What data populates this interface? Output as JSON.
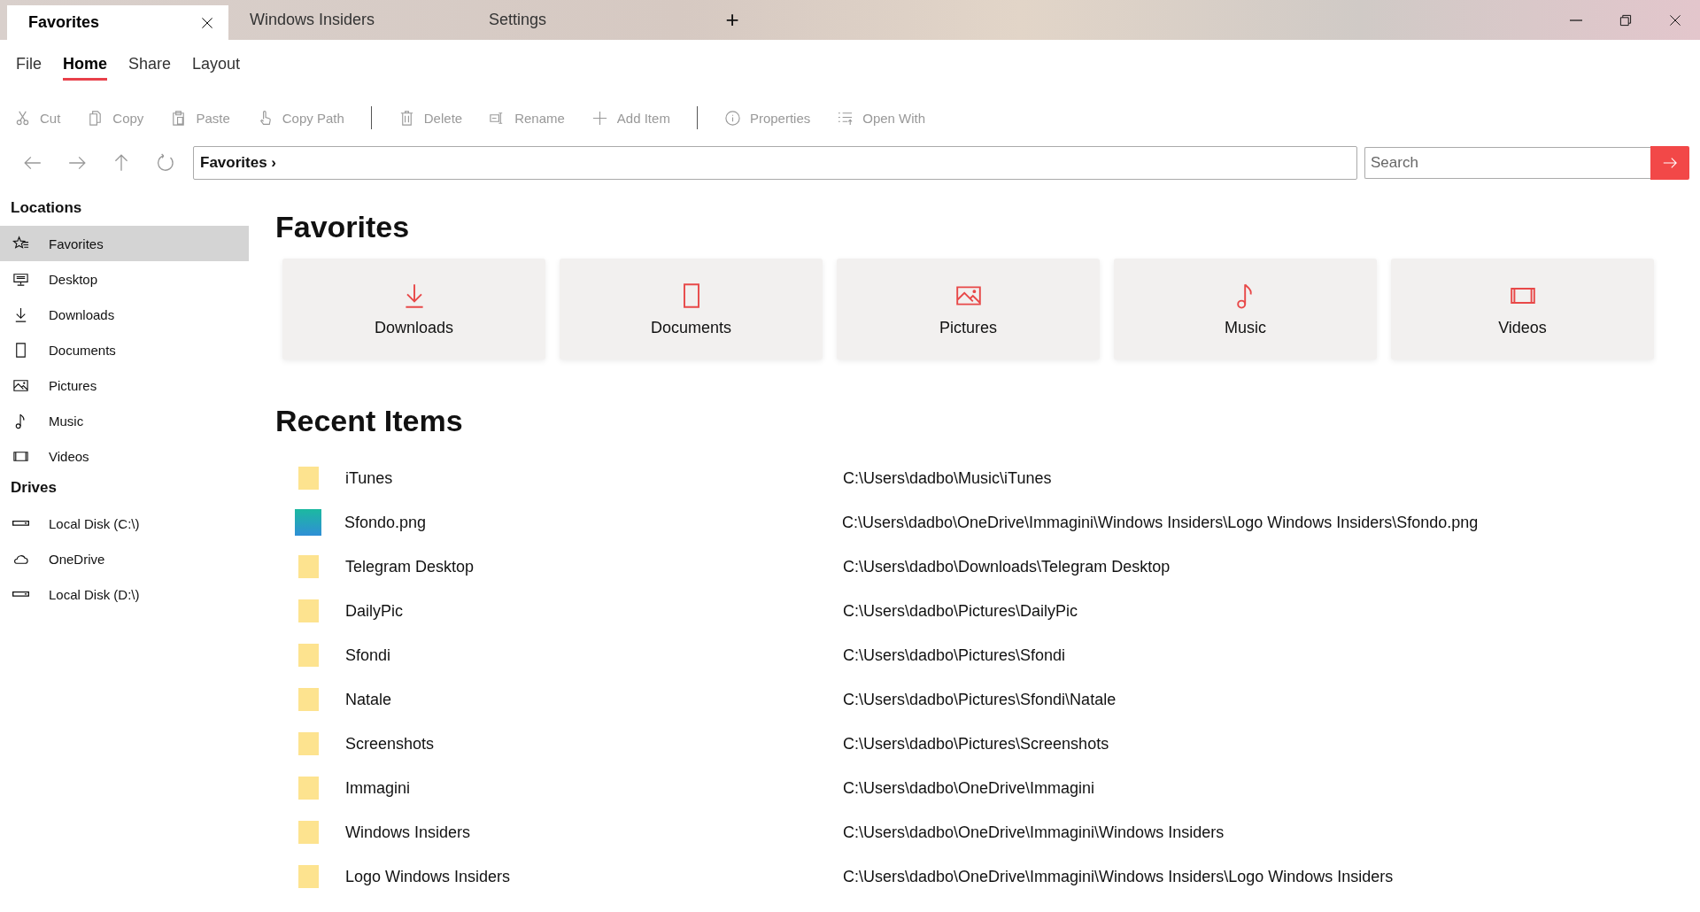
{
  "tabs": [
    {
      "label": "Favorites",
      "selected": true
    },
    {
      "label": "Windows Insiders",
      "selected": false
    },
    {
      "label": "Settings",
      "selected": false
    }
  ],
  "new_tab": "+",
  "menu": [
    {
      "label": "File",
      "selected": false
    },
    {
      "label": "Home",
      "selected": true
    },
    {
      "label": "Share",
      "selected": false
    },
    {
      "label": "Layout",
      "selected": false
    }
  ],
  "toolbar": [
    [
      {
        "label": "Cut",
        "disabled": true
      },
      {
        "label": "Copy",
        "disabled": true
      },
      {
        "label": "Paste",
        "disabled": true
      },
      {
        "label": "Copy Path",
        "disabled": true
      }
    ],
    [
      {
        "label": "Delete",
        "disabled": true
      },
      {
        "label": "Rename",
        "disabled": true
      },
      {
        "label": "Add Item",
        "disabled": true
      }
    ],
    [
      {
        "label": "Properties",
        "disabled": true
      },
      {
        "label": "Open With",
        "disabled": true
      }
    ]
  ],
  "address": "Favorites ›",
  "search": {
    "placeholder": "Search"
  },
  "sidebar": {
    "sections": [
      {
        "title": "Locations",
        "items": [
          {
            "label": "Favorites",
            "selected": true
          },
          {
            "label": "Desktop",
            "selected": false
          },
          {
            "label": "Downloads",
            "selected": false
          },
          {
            "label": "Documents",
            "selected": false
          },
          {
            "label": "Pictures",
            "selected": false
          },
          {
            "label": "Music",
            "selected": false
          },
          {
            "label": "Videos",
            "selected": false
          }
        ]
      },
      {
        "title": "Drives",
        "items": [
          {
            "label": "Local Disk (C:\\)",
            "selected": false
          },
          {
            "label": "OneDrive",
            "selected": false
          },
          {
            "label": "Local Disk (D:\\)",
            "selected": false
          }
        ]
      }
    ]
  },
  "favorites": {
    "title": "Favorites",
    "cards": [
      "Downloads",
      "Documents",
      "Pictures",
      "Music",
      "Videos"
    ]
  },
  "recent": {
    "title": "Recent Items",
    "rows": [
      {
        "kind": "folder",
        "name": "iTunes",
        "path": "C:\\Users\\dadbo\\Music\\iTunes"
      },
      {
        "kind": "image",
        "name": "Sfondo.png",
        "path": "C:\\Users\\dadbo\\OneDrive\\Immagini\\Windows Insiders\\Logo Windows Insiders\\Sfondo.png"
      },
      {
        "kind": "folder",
        "name": "Telegram Desktop",
        "path": "C:\\Users\\dadbo\\Downloads\\Telegram Desktop"
      },
      {
        "kind": "folder",
        "name": "DailyPic",
        "path": "C:\\Users\\dadbo\\Pictures\\DailyPic"
      },
      {
        "kind": "folder",
        "name": "Sfondi",
        "path": "C:\\Users\\dadbo\\Pictures\\Sfondi"
      },
      {
        "kind": "folder",
        "name": "Natale",
        "path": "C:\\Users\\dadbo\\Pictures\\Sfondi\\Natale"
      },
      {
        "kind": "folder",
        "name": "Screenshots",
        "path": "C:\\Users\\dadbo\\Pictures\\Screenshots"
      },
      {
        "kind": "folder",
        "name": "Immagini",
        "path": "C:\\Users\\dadbo\\OneDrive\\Immagini"
      },
      {
        "kind": "folder",
        "name": "Windows Insiders",
        "path": "C:\\Users\\dadbo\\OneDrive\\Immagini\\Windows Insiders"
      },
      {
        "kind": "folder",
        "name": "Logo Windows Insiders",
        "path": "C:\\Users\\dadbo\\OneDrive\\Immagini\\Windows Insiders\\Logo Windows Insiders"
      }
    ]
  }
}
